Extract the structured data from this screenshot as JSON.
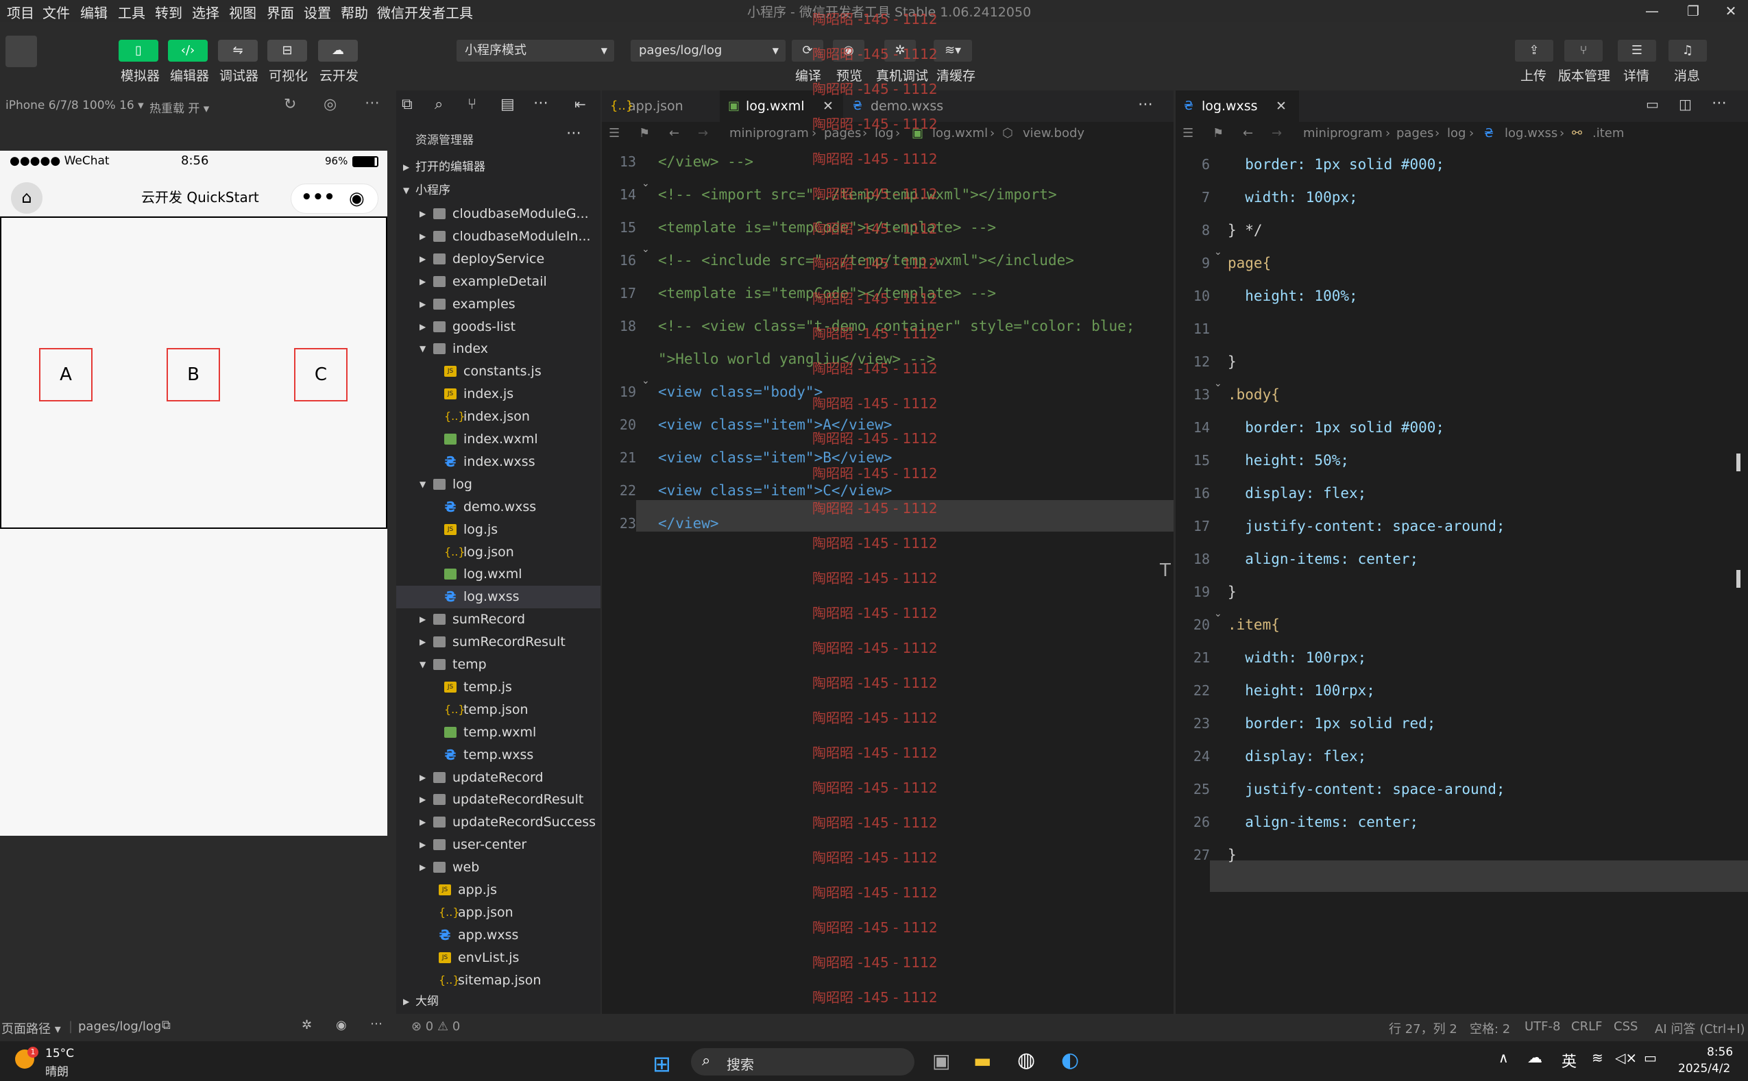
{
  "menubar": {
    "items": [
      "项目",
      "文件",
      "编辑",
      "工具",
      "转到",
      "选择",
      "视图",
      "界面",
      "设置",
      "帮助",
      "微信开发者工具"
    ],
    "title": "小程序 - 微信开发者工具 Stable 1.06.2412050"
  },
  "toolbar": {
    "left_buttons": [
      {
        "icon": "phone-icon",
        "label": "模拟器"
      },
      {
        "icon": "code-icon",
        "label": "编辑器"
      },
      {
        "icon": "debug-icon",
        "label": "调试器"
      },
      {
        "icon": "layout-icon",
        "label": "可视化"
      },
      {
        "icon": "cloud-icon",
        "label": "云开发"
      }
    ],
    "mode_select": "小程序模式",
    "page_select": "pages/log/log",
    "center_labels": [
      "编译",
      "预览",
      "真机调试",
      "清缓存"
    ],
    "right_buttons": [
      "上传",
      "版本管理",
      "详情",
      "消息"
    ]
  },
  "simulator": {
    "device": "iPhone 6/7/8 100% 16",
    "hotreload": "热重载 开",
    "status": {
      "carrier": "●●●●● WeChat",
      "time": "8:56",
      "battery": "96%"
    },
    "nav_title": "云开发 QuickStart",
    "items": [
      "A",
      "B",
      "C"
    ],
    "footer": {
      "path_label": "页面路径",
      "path": "pages/log/log"
    }
  },
  "explorer": {
    "title": "资源管理器",
    "open_editors": "打开的编辑器",
    "project": "小程序",
    "outline": "大纲",
    "tree": [
      {
        "name": "cloudbaseModuleG...",
        "type": "folder",
        "depth": 1,
        "open": false
      },
      {
        "name": "cloudbaseModuleIn...",
        "type": "folder",
        "depth": 1,
        "open": false
      },
      {
        "name": "deployService",
        "type": "folder",
        "depth": 1,
        "open": false
      },
      {
        "name": "exampleDetail",
        "type": "folder",
        "depth": 1,
        "open": false
      },
      {
        "name": "examples",
        "type": "folder",
        "depth": 1,
        "open": false
      },
      {
        "name": "goods-list",
        "type": "folder",
        "depth": 1,
        "open": false
      },
      {
        "name": "index",
        "type": "folder",
        "depth": 1,
        "open": true
      },
      {
        "name": "constants.js",
        "type": "js",
        "depth": 2
      },
      {
        "name": "index.js",
        "type": "js",
        "depth": 2
      },
      {
        "name": "index.json",
        "type": "json",
        "depth": 2
      },
      {
        "name": "index.wxml",
        "type": "wxml",
        "depth": 2
      },
      {
        "name": "index.wxss",
        "type": "wxss",
        "depth": 2
      },
      {
        "name": "log",
        "type": "folder",
        "depth": 1,
        "open": true
      },
      {
        "name": "demo.wxss",
        "type": "wxss",
        "depth": 2
      },
      {
        "name": "log.js",
        "type": "js",
        "depth": 2
      },
      {
        "name": "log.json",
        "type": "json",
        "depth": 2
      },
      {
        "name": "log.wxml",
        "type": "wxml",
        "depth": 2
      },
      {
        "name": "log.wxss",
        "type": "wxss",
        "depth": 2,
        "selected": true
      },
      {
        "name": "sumRecord",
        "type": "folder",
        "depth": 1,
        "open": false
      },
      {
        "name": "sumRecordResult",
        "type": "folder",
        "depth": 1,
        "open": false
      },
      {
        "name": "temp",
        "type": "folder",
        "depth": 1,
        "open": true
      },
      {
        "name": "temp.js",
        "type": "js",
        "depth": 2
      },
      {
        "name": "temp.json",
        "type": "json",
        "depth": 2
      },
      {
        "name": "temp.wxml",
        "type": "wxml",
        "depth": 2
      },
      {
        "name": "temp.wxss",
        "type": "wxss",
        "depth": 2
      },
      {
        "name": "updateRecord",
        "type": "folder",
        "depth": 1,
        "open": false
      },
      {
        "name": "updateRecordResult",
        "type": "folder",
        "depth": 1,
        "open": false
      },
      {
        "name": "updateRecordSuccess",
        "type": "folder",
        "depth": 1,
        "open": false
      },
      {
        "name": "user-center",
        "type": "folder",
        "depth": 1,
        "open": false
      },
      {
        "name": "web",
        "type": "folder",
        "depth": 1,
        "open": false
      },
      {
        "name": "app.js",
        "type": "js",
        "depth": 0
      },
      {
        "name": "app.json",
        "type": "json",
        "depth": 0
      },
      {
        "name": "app.wxss",
        "type": "wxss",
        "depth": 0
      },
      {
        "name": "envList.js",
        "type": "js",
        "depth": 0
      },
      {
        "name": "sitemap.json",
        "type": "json",
        "depth": 0
      }
    ]
  },
  "editor1": {
    "tabs": [
      "app.json",
      "log.wxml",
      "demo.wxss"
    ],
    "breadcrumb": [
      "miniprogram",
      "pages",
      "log",
      "log.wxml",
      "view.body"
    ],
    "lines": [
      {
        "n": "13",
        "t": "</view> -->",
        "c": "cm"
      },
      {
        "n": "14",
        "t": "<!-- <import src=\"../temp/temp.wxml\"></import>",
        "c": "cm"
      },
      {
        "n": "15",
        "t": "<template is=\"tempCode\"></template> -->",
        "c": "cm"
      },
      {
        "n": "16",
        "t": "<!-- <include src=\"../temp/temp.wxml\"></include>",
        "c": "cm"
      },
      {
        "n": "17",
        "t": "<template is=\"tempCode\"></template> -->",
        "c": "cm"
      },
      {
        "n": "18",
        "t": "<!-- <view class=\"t-demo container\" style=\"color: blue;",
        "c": "cm"
      },
      {
        "n": "",
        "t": "\">Hello world yangliu</view> -->",
        "c": "cm"
      },
      {
        "n": "19",
        "t": "<view class=\"body\">",
        "c": "tag"
      },
      {
        "n": "20",
        "t": "<view class=\"item\">A</view>",
        "c": "tag"
      },
      {
        "n": "21",
        "t": "<view class=\"item\">B</view>",
        "c": "tag"
      },
      {
        "n": "22",
        "t": "<view class=\"item\">C</view>",
        "c": "tag"
      },
      {
        "n": "23",
        "t": "</view>",
        "c": "tag"
      }
    ],
    "watermark": "陶昭昭 -145 - 1112"
  },
  "editor2": {
    "tab": "log.wxss",
    "breadcrumb": [
      "miniprogram",
      "pages",
      "log",
      "log.wxss",
      ".item"
    ],
    "lines": [
      {
        "n": "6",
        "t": "  border: 1px solid #000;"
      },
      {
        "n": "7",
        "t": "  width: 100px;"
      },
      {
        "n": "8",
        "t": "} */"
      },
      {
        "n": "9",
        "t": "page{"
      },
      {
        "n": "10",
        "t": "  height: 100%;"
      },
      {
        "n": "11",
        "t": ""
      },
      {
        "n": "12",
        "t": "}"
      },
      {
        "n": "13",
        "t": ".body{"
      },
      {
        "n": "14",
        "t": "  border: 1px solid #000;"
      },
      {
        "n": "15",
        "t": "  height: 50%;"
      },
      {
        "n": "16",
        "t": "  display: flex;"
      },
      {
        "n": "17",
        "t": "  justify-content: space-around;"
      },
      {
        "n": "18",
        "t": "  align-items: center;"
      },
      {
        "n": "19",
        "t": "}"
      },
      {
        "n": "20",
        "t": ".item{"
      },
      {
        "n": "21",
        "t": "  width: 100rpx;"
      },
      {
        "n": "22",
        "t": "  height: 100rpx;"
      },
      {
        "n": "23",
        "t": "  border: 1px solid red;"
      },
      {
        "n": "24",
        "t": "  display: flex;"
      },
      {
        "n": "25",
        "t": "  justify-content: space-around;"
      },
      {
        "n": "26",
        "t": "  align-items: center;"
      },
      {
        "n": "27",
        "t": "}"
      }
    ]
  },
  "statusbar": {
    "problems": "⊗ 0 ⚠ 0",
    "position": "行 27，列 2",
    "spaces": "空格: 2",
    "encoding": "UTF-8",
    "eol": "CRLF",
    "lang": "CSS",
    "ai": "AI 问答 (Ctrl+I)"
  },
  "taskbar": {
    "temp": "15°C",
    "weather": "晴朗",
    "search": "搜索",
    "ime": "英",
    "time": "8:56",
    "date": "2025/4/2",
    "badge": "1"
  },
  "colors": {
    "accent": "#07c160",
    "item_border": "#e53935"
  }
}
